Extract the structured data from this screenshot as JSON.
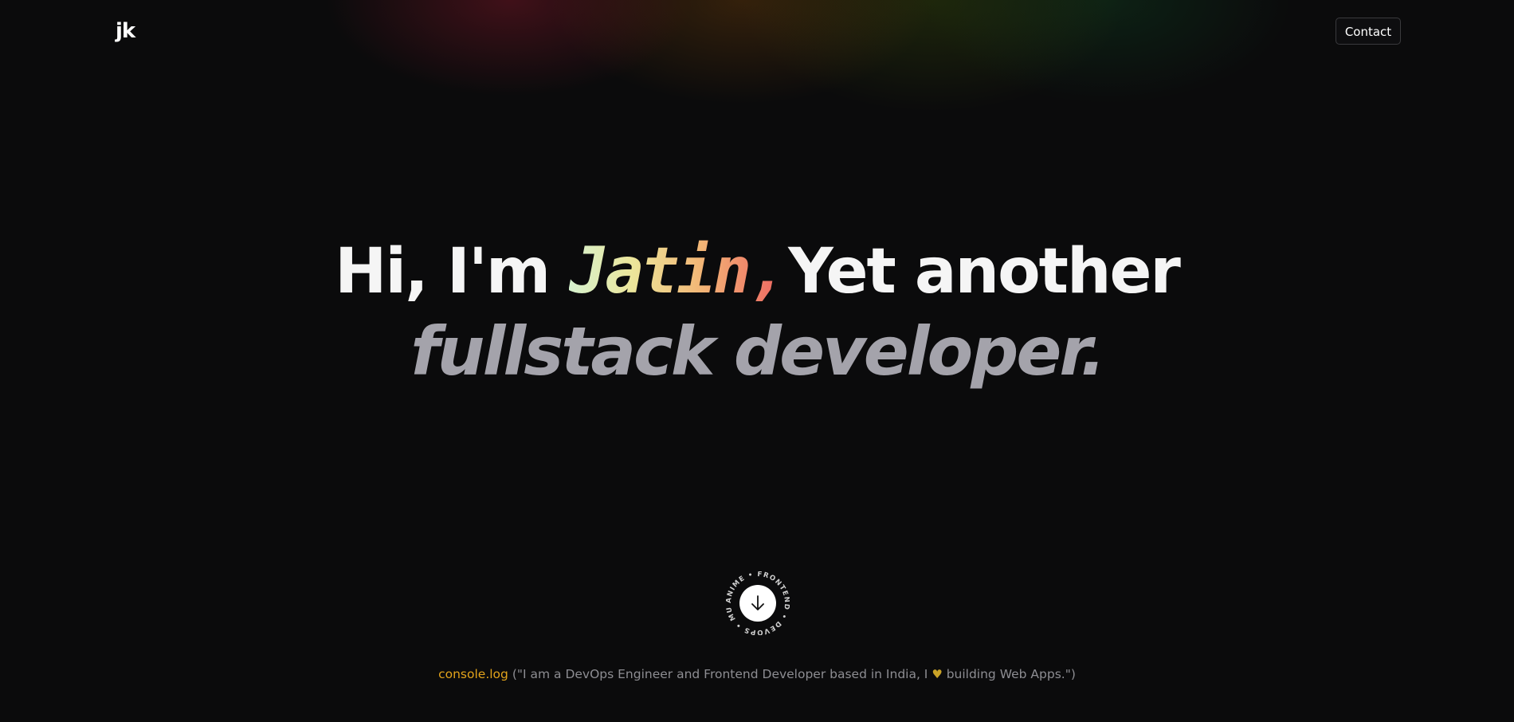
{
  "header": {
    "logo_text": "jk",
    "contact_label": "Contact"
  },
  "hero": {
    "greeting": "Hi, I'm ",
    "name": "Jatin,",
    "line1_rest": "Yet another",
    "line2": "fullstack developer."
  },
  "scroll_badge": {
    "ring_text": "ANIME • FRONTEND • DEVOPS • MUSIC •",
    "icon": "arrow-down-icon"
  },
  "footer": {
    "console_keyword": "console.log",
    "message_before_heart": " (\"I am a DevOps Engineer and Frontend Developer based in India, I ",
    "heart_icon": "heart-icon",
    "heart_glyph": "♥",
    "message_after_heart": " building Web Apps.\")"
  },
  "colors": {
    "background": "#0b0b0c",
    "heading": "#f5f5f5",
    "subheading": "#a4a3ab",
    "console_accent": "#e2a31b",
    "footer_text": "#8d8d92"
  }
}
